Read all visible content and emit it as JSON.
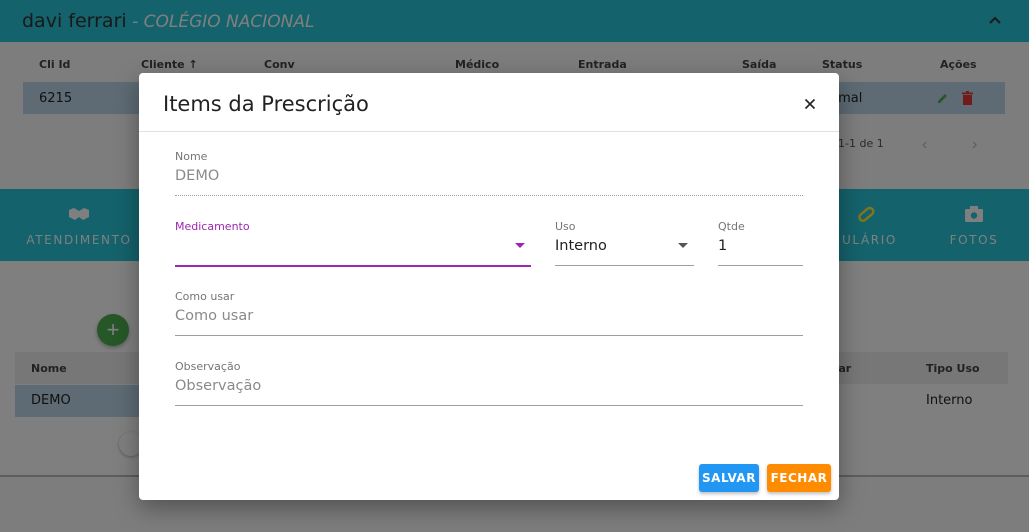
{
  "header": {
    "user_name": "davi ferrari",
    "separator": " - ",
    "org_name": "COLÉGIO NACIONAL"
  },
  "patients_grid": {
    "columns": [
      "Cli Id",
      "Cliente",
      "Conv",
      "Médico",
      "Entrada",
      "Saída",
      "Status",
      "Ações"
    ],
    "row": {
      "cli_id": "6215",
      "status": "rmal"
    },
    "pagination": "1-1 de 1"
  },
  "tabs": [
    {
      "label": "ATENDIMENTO",
      "icon": "handshake-icon"
    },
    {
      "label": "ULÁRIO",
      "icon": "pill-icon"
    },
    {
      "label": "FOTOS",
      "icon": "camera-icon"
    }
  ],
  "items_table": {
    "columns": [
      "Nome",
      "usar",
      "Tipo Uso"
    ],
    "row": {
      "nome": "DEMO",
      "tipo_uso": "Interno"
    }
  },
  "dialog": {
    "title": "Items da Prescrição",
    "fields": {
      "nome": {
        "label": "Nome",
        "value": "DEMO"
      },
      "medicamento": {
        "label": "Medicamento",
        "value": ""
      },
      "uso": {
        "label": "Uso",
        "value": "Interno"
      },
      "qtde": {
        "label": "Qtde",
        "value": "1"
      },
      "como_usar": {
        "label": "Como usar",
        "placeholder": "Como usar"
      },
      "observacao": {
        "label": "Observação",
        "placeholder": "Observação"
      }
    },
    "buttons": {
      "save": "SALVAR",
      "close": "FECHAR"
    }
  },
  "colors": {
    "primary": "#29c4d6",
    "save": "#2196f3",
    "close": "#ff8c00",
    "focus": "#9c27b0",
    "fab": "#4caf50"
  }
}
